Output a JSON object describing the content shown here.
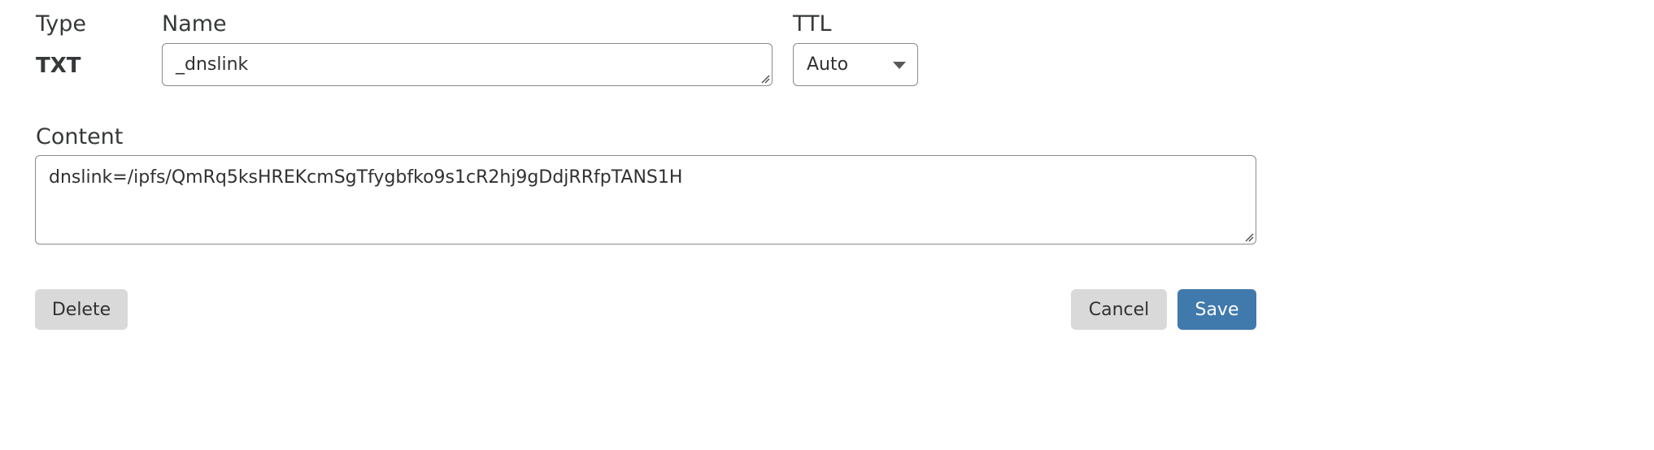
{
  "form": {
    "type_label": "Type",
    "type_value": "TXT",
    "name_label": "Name",
    "name_value": "_dnslink",
    "ttl_label": "TTL",
    "ttl_value": "Auto",
    "content_label": "Content",
    "content_value": "dnslink=/ipfs/QmRq5ksHREKcmSgTfygbfko9s1cR2hj9gDdjRRfpTANS1H"
  },
  "actions": {
    "delete_label": "Delete",
    "cancel_label": "Cancel",
    "save_label": "Save"
  },
  "colors": {
    "primary": "#4079ac",
    "secondary": "#d9d9d9",
    "border": "#8a8a8a",
    "text": "#313131"
  },
  "icons": {
    "ttl_dropdown": "chevron-down-icon",
    "textarea_resize": "resize-grip-icon"
  }
}
